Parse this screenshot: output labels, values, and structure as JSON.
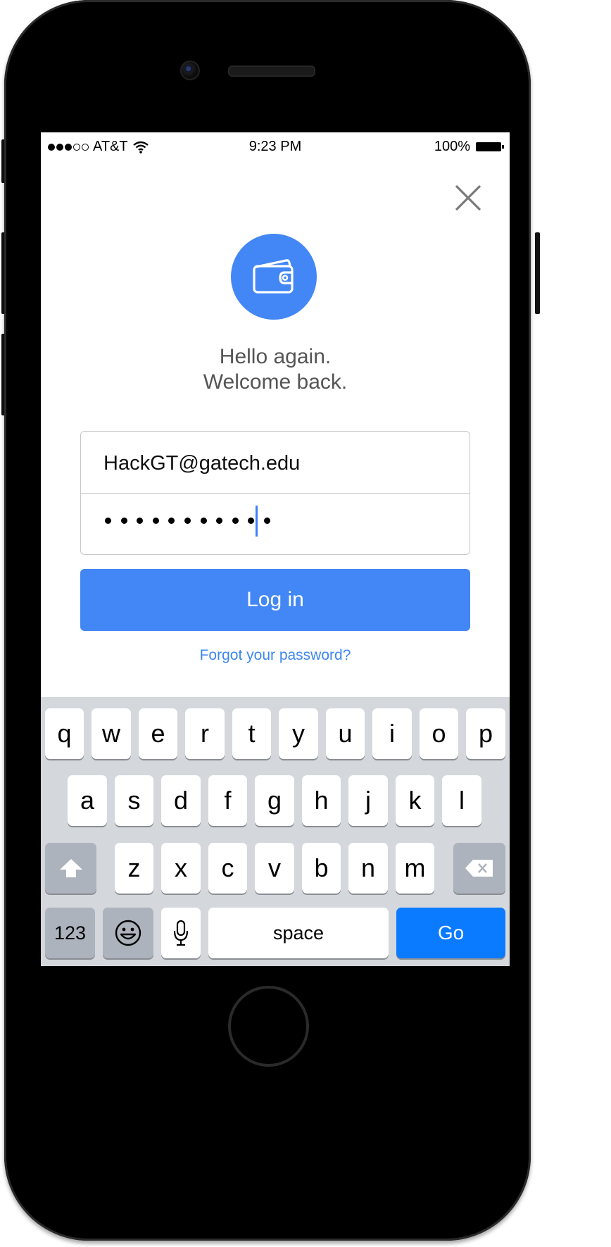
{
  "status_bar": {
    "carrier": "AT&T",
    "time": "9:23 PM",
    "battery_percent": "100%",
    "signal_bars_filled": 3,
    "signal_bars_total": 5
  },
  "login": {
    "greeting_line1": "Hello again.",
    "greeting_line2": "Welcome back.",
    "email_value": "HackGT@gatech.edu",
    "password_mask_count": 11,
    "login_button_label": "Log in",
    "forgot_link": "Forgot your password?"
  },
  "icons": {
    "close": "close-icon",
    "logo": "wallet-icon",
    "wifi": "wifi-icon",
    "battery": "battery-icon"
  },
  "keyboard": {
    "row1": [
      "q",
      "w",
      "e",
      "r",
      "t",
      "y",
      "u",
      "i",
      "o",
      "p"
    ],
    "row2": [
      "a",
      "s",
      "d",
      "f",
      "g",
      "h",
      "j",
      "k",
      "l"
    ],
    "row3": [
      "z",
      "x",
      "c",
      "v",
      "b",
      "n",
      "m"
    ],
    "numbers_label": "123",
    "space_label": "space",
    "go_label": "Go"
  },
  "colors": {
    "accent": "#4287f5",
    "link": "#3d86f0",
    "go_key": "#0a7aff",
    "keyboard_bg": "#d4d7dc"
  }
}
